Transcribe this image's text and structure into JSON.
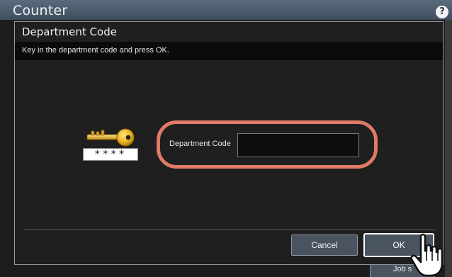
{
  "background": {
    "title": "Counter",
    "help_icon": "question-mark-icon",
    "help_glyph": "?",
    "job_button_label": "Job s"
  },
  "dialog": {
    "title": "Department Code",
    "message": "Key in the department code and press OK.",
    "key_icon": "key-icon",
    "masked_code": "****",
    "field_label": "Department Code",
    "field_value": "",
    "cancel_label": "Cancel",
    "ok_label": "OK",
    "highlight_color": "#e07a67"
  },
  "cursor": {
    "icon": "pointing-hand-cursor"
  }
}
